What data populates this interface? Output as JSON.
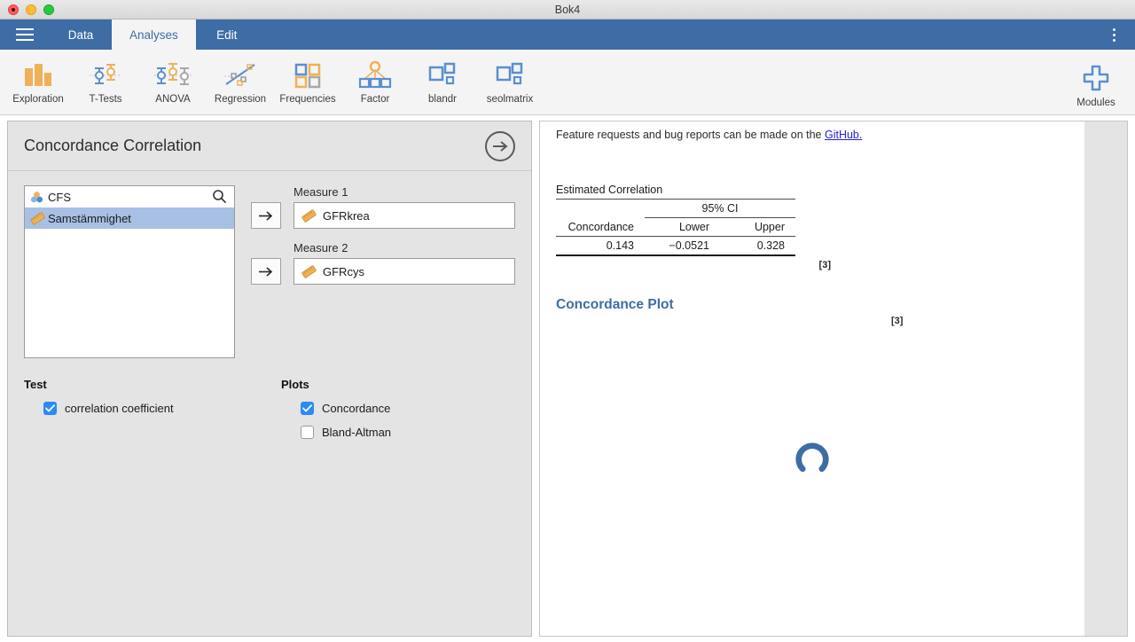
{
  "window": {
    "title": "Bok4",
    "controls": [
      "close",
      "minimize",
      "zoom"
    ]
  },
  "tabbar": {
    "menu_icon": "hamburger-icon",
    "kebab_icon": "overflow-menu-icon",
    "tabs": [
      {
        "label": "Data",
        "active": false
      },
      {
        "label": "Analyses",
        "active": true
      },
      {
        "label": "Edit",
        "active": false
      }
    ]
  },
  "ribbon": {
    "items": [
      {
        "label": "Exploration",
        "icon": "bar-chart-icon"
      },
      {
        "label": "T-Tests",
        "icon": "error-bars-icon"
      },
      {
        "label": "ANOVA",
        "icon": "error-bars-triple-icon"
      },
      {
        "label": "Regression",
        "icon": "scatter-line-icon"
      },
      {
        "label": "Frequencies",
        "icon": "squares-grid-icon"
      },
      {
        "label": "Factor",
        "icon": "factor-tree-icon"
      },
      {
        "label": "blandr",
        "icon": "squares-cluster-icon"
      },
      {
        "label": "seolmatrix",
        "icon": "squares-cluster-icon"
      }
    ],
    "modules": {
      "label": "Modules",
      "icon": "plus-cross-icon"
    }
  },
  "options_panel": {
    "title": "Concordance Correlation",
    "collapse_icon": "arrow-right-circle-icon",
    "variables": {
      "search_icon": "search-icon",
      "items": [
        {
          "name": "CFS",
          "measure_icon": "nominal-icon",
          "selected": false
        },
        {
          "name": "Samstämmighet",
          "measure_icon": "continuous-ruler-icon",
          "selected": true
        }
      ]
    },
    "fields": [
      {
        "label": "Measure 1",
        "value": "GFRkrea",
        "value_icon": "continuous-ruler-icon",
        "transfer_icon": "arrow-right-icon"
      },
      {
        "label": "Measure 2",
        "value": "GFRcys",
        "value_icon": "continuous-ruler-icon",
        "transfer_icon": "arrow-right-icon"
      }
    ],
    "test_group": {
      "title": "Test",
      "options": [
        {
          "label": "correlation coefficient",
          "checked": true
        }
      ]
    },
    "plots_group": {
      "title": "Plots",
      "options": [
        {
          "label": "Concordance",
          "checked": true
        },
        {
          "label": "Bland-Altman",
          "checked": false
        }
      ]
    }
  },
  "results": {
    "note_prefix": "Feature requests and bug reports can be made on the ",
    "note_link": "GitHub.",
    "table": {
      "title": "Estimated Correlation",
      "ci_header": "95% CI",
      "columns": [
        "Concordance",
        "Lower",
        "Upper"
      ],
      "rows": [
        [
          "0.143",
          "−0.0521",
          "0.328"
        ]
      ],
      "footnote": "[3]"
    },
    "plot": {
      "title": "Concordance Plot",
      "footnote": "[3]",
      "state": "loading",
      "spinner_icon": "loading-spinner-icon",
      "spinner_color": "#3e6da5"
    }
  },
  "colors": {
    "chrome_blue": "#3e6da5",
    "panel_gray": "#e4e4e4",
    "selection_blue": "#a8c0e4",
    "checkbox_blue": "#2a8bf2",
    "accent_orange": "#efb158"
  }
}
